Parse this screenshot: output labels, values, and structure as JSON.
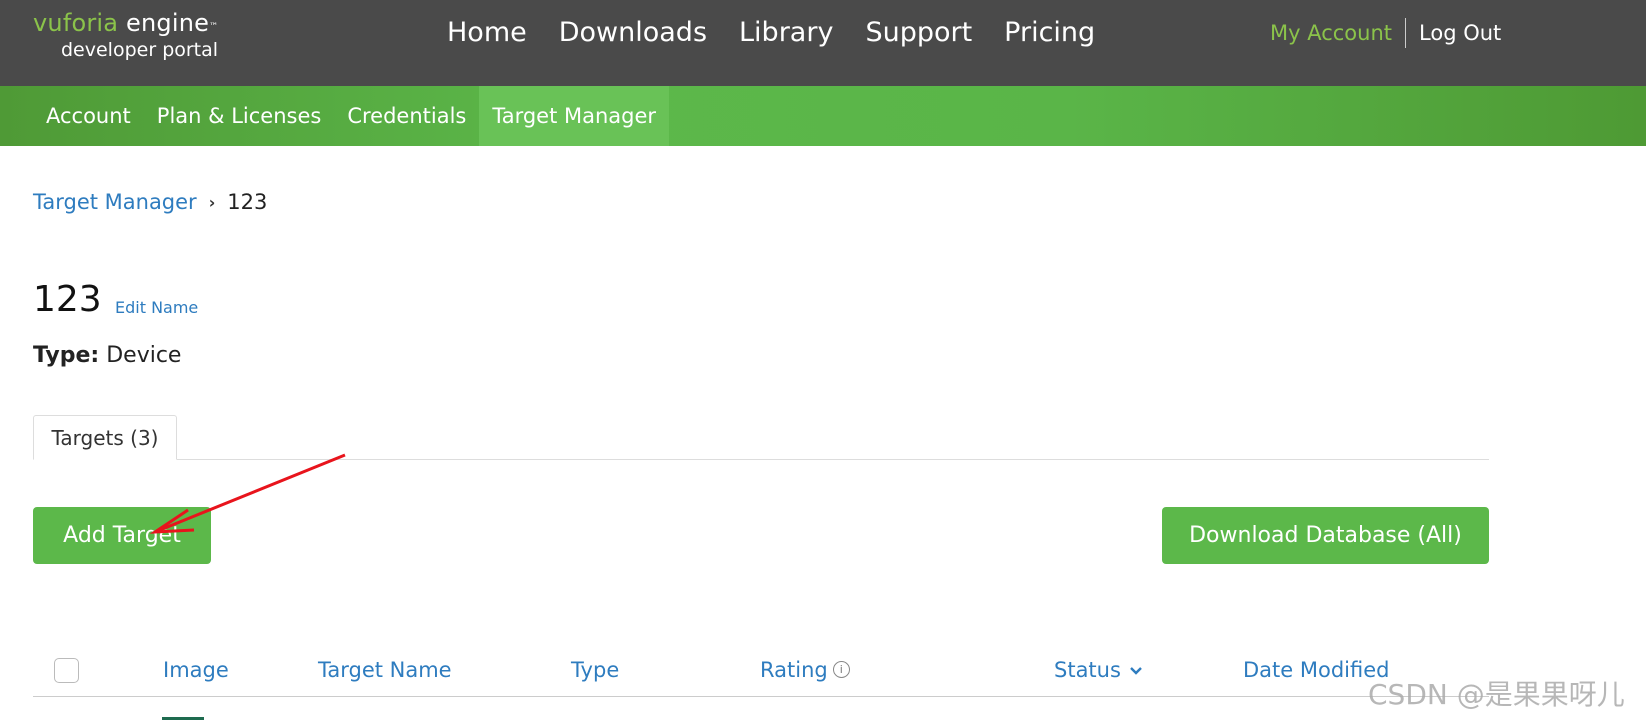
{
  "header": {
    "logo": {
      "brand": "vuforia",
      "product": "engine",
      "trademark": "™",
      "subtitle": "developer portal"
    },
    "nav": [
      "Home",
      "Downloads",
      "Library",
      "Support",
      "Pricing"
    ],
    "my_account": "My Account",
    "log_out": "Log Out"
  },
  "subnav": {
    "items": [
      "Account",
      "Plan & Licenses",
      "Credentials",
      "Target Manager"
    ],
    "active": "Target Manager"
  },
  "breadcrumb": {
    "parent": "Target Manager",
    "current": "123"
  },
  "database": {
    "name": "123",
    "edit_label": "Edit Name",
    "type_label": "Type:",
    "type_value": "Device"
  },
  "tabs": {
    "targets_label": "Targets (3)"
  },
  "actions": {
    "add_target": "Add Target",
    "download_database": "Download Database (All)"
  },
  "table": {
    "columns": [
      "Image",
      "Target Name",
      "Type",
      "Rating",
      "Status",
      "Date Modified"
    ],
    "rating_info_icon": "info-icon",
    "status_sort_icon": "chevron-down-icon"
  },
  "annotation": {
    "arrow_color": "#e8141c"
  },
  "watermark": "CSDN @是果果呀儿",
  "colors": {
    "header_bg": "#4a4a4a",
    "accent_green": "#5cb84a",
    "link_blue": "#2e7cbf",
    "logo_green": "#8bc34a"
  }
}
